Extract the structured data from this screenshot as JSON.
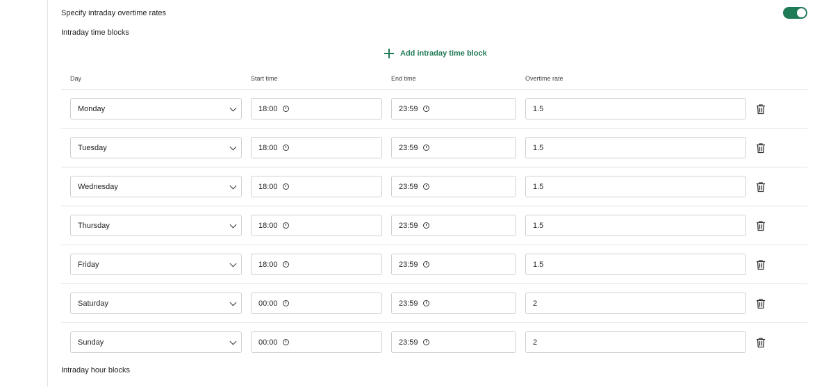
{
  "overtime": {
    "toggle_label": "Specify intraday overtime rates",
    "toggle_on": true,
    "accent_color": "#1f7a56"
  },
  "time_blocks": {
    "title": "Intraday time blocks",
    "add_label": "Add intraday time block",
    "columns": {
      "day": "Day",
      "start": "Start time",
      "end": "End time",
      "rate": "Overtime rate"
    },
    "rows": [
      {
        "day": "Monday",
        "start": "18:00",
        "end": "23:59",
        "rate": "1.5"
      },
      {
        "day": "Tuesday",
        "start": "18:00",
        "end": "23:59",
        "rate": "1.5"
      },
      {
        "day": "Wednesday",
        "start": "18:00",
        "end": "23:59",
        "rate": "1.5"
      },
      {
        "day": "Thursday",
        "start": "18:00",
        "end": "23:59",
        "rate": "1.5"
      },
      {
        "day": "Friday",
        "start": "18:00",
        "end": "23:59",
        "rate": "1.5"
      },
      {
        "day": "Saturday",
        "start": "00:00",
        "end": "23:59",
        "rate": "2"
      },
      {
        "day": "Sunday",
        "start": "00:00",
        "end": "23:59",
        "rate": "2"
      }
    ]
  },
  "hour_blocks": {
    "title": "Intraday hour blocks"
  },
  "icons": {
    "add": "plus-icon",
    "select": "chevron-down-icon",
    "time": "clock-icon",
    "delete": "trash-icon"
  }
}
